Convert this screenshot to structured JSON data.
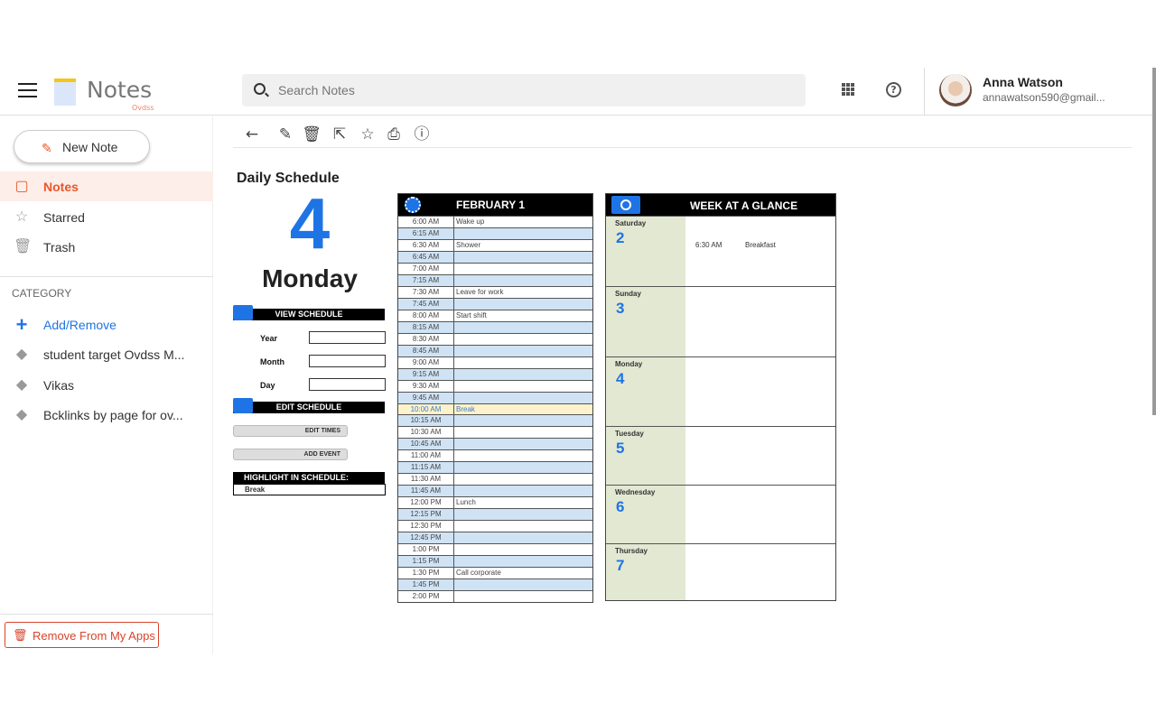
{
  "header": {
    "logo_text": "Notes",
    "logo_sub": "Ovdss",
    "search_placeholder": "Search Notes",
    "user_name": "Anna Watson",
    "user_email": "annawatson590@gmail..."
  },
  "sidebar": {
    "new_note": "New Note",
    "nav": [
      {
        "label": "Notes",
        "icon": "note-icon",
        "active": true
      },
      {
        "label": "Starred",
        "icon": "star-icon"
      },
      {
        "label": "Trash",
        "icon": "trash-icon"
      }
    ],
    "category_heading": "CATEGORY",
    "categories": [
      {
        "label": "Add/Remove",
        "icon": "plus-icon"
      },
      {
        "label": "student target Ovdss M...",
        "icon": "tag-icon"
      },
      {
        "label": "Vikas",
        "icon": "tag-icon"
      },
      {
        "label": "Bcklinks by page for ov...",
        "icon": "tag-icon"
      }
    ],
    "remove_label": "Remove From My Apps"
  },
  "toolbar": [
    "back-icon",
    "edit-icon",
    "trash-icon",
    "share-icon",
    "star-icon",
    "print-icon",
    "info-icon"
  ],
  "schedule": {
    "title": "Daily Schedule",
    "day_number": "4",
    "day_name": "Monday",
    "view_schedule": "VIEW SCHEDULE",
    "year_label": "Year",
    "month_label": "Month",
    "day_label": "Day",
    "edit_schedule": "EDIT SCHEDULE",
    "edit_times": "EDIT TIMES",
    "add_event": "ADD EVENT",
    "highlight_label": "HIGHLIGHT IN SCHEDULE:",
    "highlight_value": "Break",
    "accent": "#1f74e5",
    "daily_header": "FEBRUARY 1",
    "slots": [
      [
        "6:00 AM",
        "Wake up"
      ],
      [
        "6:15 AM",
        ""
      ],
      [
        "6:30 AM",
        "Shower"
      ],
      [
        "6:45 AM",
        ""
      ],
      [
        "7:00 AM",
        ""
      ],
      [
        "7:15 AM",
        ""
      ],
      [
        "7:30 AM",
        "Leave for work"
      ],
      [
        "7:45 AM",
        ""
      ],
      [
        "8:00 AM",
        "Start shift"
      ],
      [
        "8:15 AM",
        ""
      ],
      [
        "8:30 AM",
        ""
      ],
      [
        "8:45 AM",
        ""
      ],
      [
        "9:00 AM",
        ""
      ],
      [
        "9:15 AM",
        ""
      ],
      [
        "9:30 AM",
        ""
      ],
      [
        "9:45 AM",
        ""
      ],
      [
        "10:00 AM",
        "Break"
      ],
      [
        "10:15 AM",
        ""
      ],
      [
        "10:30 AM",
        ""
      ],
      [
        "10:45 AM",
        ""
      ],
      [
        "11:00 AM",
        ""
      ],
      [
        "11:15 AM",
        ""
      ],
      [
        "11:30 AM",
        ""
      ],
      [
        "11:45 AM",
        ""
      ],
      [
        "12:00 PM",
        "Lunch"
      ],
      [
        "12:15 PM",
        ""
      ],
      [
        "12:30 PM",
        ""
      ],
      [
        "12:45 PM",
        ""
      ],
      [
        "1:00 PM",
        ""
      ],
      [
        "1:15 PM",
        ""
      ],
      [
        "1:30 PM",
        "Call corporate"
      ],
      [
        "1:45 PM",
        ""
      ],
      [
        "2:00 PM",
        ""
      ]
    ],
    "highlight_index": 16,
    "week_header": "WEEK AT A GLANCE",
    "week": [
      {
        "day": "Saturday",
        "date": "2",
        "time": "6:30 AM",
        "event": "Breakfast"
      },
      {
        "day": "Sunday",
        "date": "3"
      },
      {
        "day": "Monday",
        "date": "4"
      },
      {
        "day": "Tuesday",
        "date": "5"
      },
      {
        "day": "Wednesday",
        "date": "6"
      },
      {
        "day": "Thursday",
        "date": "7"
      }
    ]
  }
}
